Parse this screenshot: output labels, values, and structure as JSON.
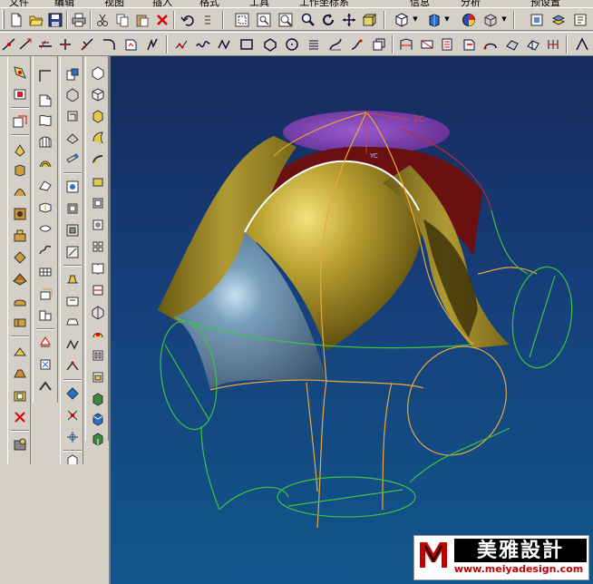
{
  "menu": {
    "items": [
      "文件",
      "编辑",
      "视图",
      "插入",
      "格式",
      "工具",
      "工作坐标系",
      "信息",
      "分析",
      "预设置"
    ]
  },
  "viewport": {
    "axis_label_z": "ZC",
    "axis_label_y": "YC"
  },
  "watermark": {
    "brand_cn": "美雅設計",
    "url": "www.meiyadesign.com"
  },
  "colors": {
    "viewport_top": "#172a5c",
    "viewport_bottom": "#11568c",
    "surface_gold": "#a8902a",
    "surface_red": "#7a1414",
    "surface_purple": "#7b3aa8",
    "surface_steel": "#6c8fab",
    "curve_orange": "#e8a93a",
    "curve_green": "#3ec43e"
  },
  "icons": {
    "toolbar1": [
      "new-file-icon",
      "open-folder-icon",
      "save-icon",
      "print-icon",
      "cut-icon",
      "copy-icon",
      "paste-icon",
      "delete-icon",
      "undo-icon",
      "fit-view-icon",
      "zoom-window-icon",
      "zoom-icon",
      "rotate-icon",
      "pan-icon",
      "wcs-icon",
      "shaded-cube-icon",
      "render-icon",
      "analysis-sphere-icon",
      "box-icon",
      "preferences-icon"
    ],
    "toolbar2": [
      "sketch-icon",
      "line-icon",
      "arc-icon",
      "point-icon",
      "spline-icon",
      "rectangle-icon",
      "circle-icon",
      "polygon-icon",
      "helix-icon",
      "offset-curve-icon",
      "project-curve-icon",
      "trim-curve-icon",
      "extract-curve-icon",
      "bridge-curve-icon",
      "join-curve-icon"
    ]
  }
}
